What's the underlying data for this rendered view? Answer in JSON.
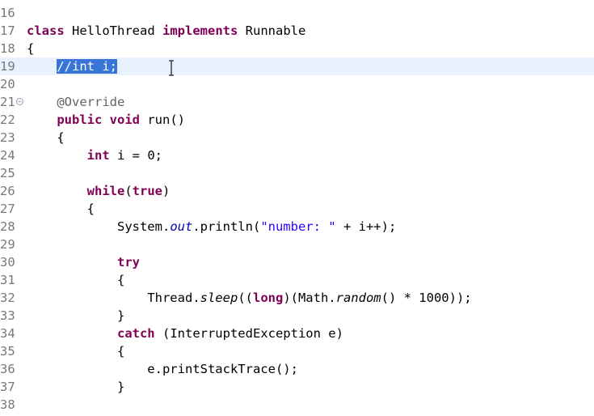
{
  "editor": {
    "lines": [
      {
        "no": "16",
        "segments": []
      },
      {
        "no": "17",
        "segments": [
          {
            "t": "class",
            "k": "kw"
          },
          {
            "t": " HelloThread "
          },
          {
            "t": "implements",
            "k": "kw"
          },
          {
            "t": " Runnable"
          }
        ]
      },
      {
        "no": "18",
        "segments": [
          {
            "t": "{"
          }
        ]
      },
      {
        "no": "19",
        "current": true,
        "segments": [
          {
            "t": "    "
          },
          {
            "t": "//int i;",
            "k": "cm sel"
          }
        ]
      },
      {
        "no": "20",
        "segments": []
      },
      {
        "no": "21",
        "fold": true,
        "segments": [
          {
            "t": "    "
          },
          {
            "t": "@Override",
            "k": "an"
          }
        ]
      },
      {
        "no": "22",
        "segments": [
          {
            "t": "    "
          },
          {
            "t": "public",
            "k": "kw"
          },
          {
            "t": " "
          },
          {
            "t": "void",
            "k": "kw"
          },
          {
            "t": " run()"
          }
        ]
      },
      {
        "no": "23",
        "segments": [
          {
            "t": "    {"
          }
        ]
      },
      {
        "no": "24",
        "segments": [
          {
            "t": "        "
          },
          {
            "t": "int",
            "k": "kw"
          },
          {
            "t": " i = 0;"
          }
        ]
      },
      {
        "no": "25",
        "segments": []
      },
      {
        "no": "26",
        "segments": [
          {
            "t": "        "
          },
          {
            "t": "while",
            "k": "kw"
          },
          {
            "t": "("
          },
          {
            "t": "true",
            "k": "kw"
          },
          {
            "t": ")"
          }
        ]
      },
      {
        "no": "27",
        "segments": [
          {
            "t": "        {"
          }
        ]
      },
      {
        "no": "28",
        "segments": [
          {
            "t": "            System."
          },
          {
            "t": "out",
            "k": "sf"
          },
          {
            "t": ".println("
          },
          {
            "t": "\"number: \"",
            "k": "st"
          },
          {
            "t": " + i++);"
          }
        ]
      },
      {
        "no": "29",
        "segments": []
      },
      {
        "no": "30",
        "segments": [
          {
            "t": "            "
          },
          {
            "t": "try",
            "k": "kw"
          }
        ]
      },
      {
        "no": "31",
        "segments": [
          {
            "t": "            {"
          }
        ]
      },
      {
        "no": "32",
        "segments": [
          {
            "t": "                Thread."
          },
          {
            "t": "sleep",
            "k": "it"
          },
          {
            "t": "(("
          },
          {
            "t": "long",
            "k": "kw"
          },
          {
            "t": ")(Math."
          },
          {
            "t": "random",
            "k": "it"
          },
          {
            "t": "() * 1000));"
          }
        ]
      },
      {
        "no": "33",
        "segments": [
          {
            "t": "            }"
          }
        ]
      },
      {
        "no": "34",
        "segments": [
          {
            "t": "            "
          },
          {
            "t": "catch",
            "k": "kw"
          },
          {
            "t": " (InterruptedException e)"
          }
        ]
      },
      {
        "no": "35",
        "segments": [
          {
            "t": "            {"
          }
        ]
      },
      {
        "no": "36",
        "segments": [
          {
            "t": "                e.printStackTrace();"
          }
        ]
      },
      {
        "no": "37",
        "segments": [
          {
            "t": "            }"
          }
        ]
      },
      {
        "no": "38",
        "segments": []
      }
    ]
  }
}
